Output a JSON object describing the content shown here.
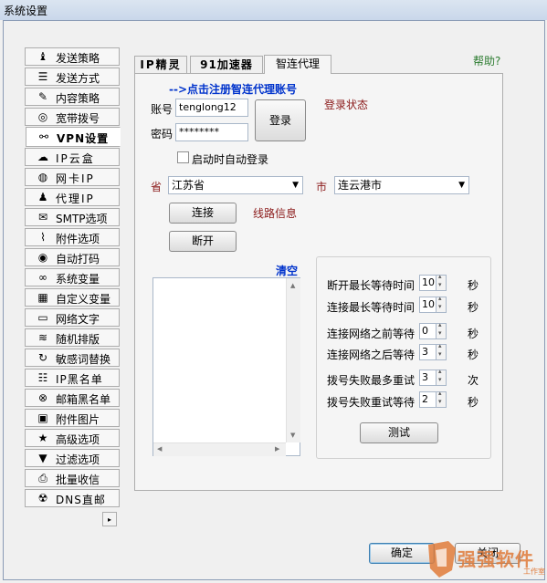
{
  "window": {
    "title": "系统设置"
  },
  "sidebar": {
    "items": [
      {
        "label": "发送策略",
        "icon": "chess-piece-icon",
        "glyph": "♝",
        "active": false
      },
      {
        "label": "发送方式",
        "icon": "list-icon",
        "glyph": "☰",
        "active": false
      },
      {
        "label": "内容策略",
        "icon": "pencil-icon",
        "glyph": "✎",
        "active": false
      },
      {
        "label": "宽带拨号",
        "icon": "globe-icon",
        "glyph": "◎",
        "active": false
      },
      {
        "label": "VPN设置",
        "icon": "link-icon",
        "glyph": "⚯",
        "active": true
      },
      {
        "label": "IP云盒",
        "icon": "cloud-icon",
        "glyph": "☁",
        "active": false
      },
      {
        "label": "网卡IP",
        "icon": "globe-icon",
        "glyph": "◍",
        "active": false
      },
      {
        "label": "代理IP",
        "icon": "user-tree-icon",
        "glyph": "♟",
        "active": false
      },
      {
        "label": "SMTP选项",
        "icon": "envelope-icon",
        "glyph": "✉",
        "active": false
      },
      {
        "label": "附件选项",
        "icon": "paperclip-icon",
        "glyph": "⌇",
        "active": false
      },
      {
        "label": "自动打码",
        "icon": "eye-icon",
        "glyph": "◉",
        "active": false
      },
      {
        "label": "系统变量",
        "icon": "infinity-icon",
        "glyph": "∞",
        "active": false
      },
      {
        "label": "自定义变量",
        "icon": "grid-icon",
        "glyph": "▦",
        "active": false
      },
      {
        "label": "网络文字",
        "icon": "book-icon",
        "glyph": "▭",
        "active": false
      },
      {
        "label": "随机排版",
        "icon": "stack-icon",
        "glyph": "≋",
        "active": false
      },
      {
        "label": "敏感词替换",
        "icon": "refresh-icon",
        "glyph": "↻",
        "active": false
      },
      {
        "label": "IP黑名单",
        "icon": "list-icon",
        "glyph": "☷",
        "active": false
      },
      {
        "label": "邮箱黑名单",
        "icon": "block-icon",
        "glyph": "⊗",
        "active": false
      },
      {
        "label": "附件图片",
        "icon": "image-icon",
        "glyph": "▣",
        "active": false
      },
      {
        "label": "高级选项",
        "icon": "star-icon",
        "glyph": "★",
        "active": false
      },
      {
        "label": "过滤选项",
        "icon": "filter-icon",
        "glyph": "▼",
        "active": false
      },
      {
        "label": "批量收信",
        "icon": "inbox-icon",
        "glyph": "⎙",
        "active": false
      },
      {
        "label": "DNS直邮",
        "icon": "radiation-icon",
        "glyph": "☢",
        "active": false
      }
    ],
    "scroll_glyph": "▸"
  },
  "tabs": [
    {
      "label": "IP精灵"
    },
    {
      "label": "91加速器"
    },
    {
      "label": "智连代理"
    }
  ],
  "help_label": "帮助?",
  "login": {
    "register_link": "-->点击注册智连代理账号",
    "account_label": "账号",
    "account_value": "tenglong12",
    "password_label": "密码",
    "password_value": "********",
    "login_button": "登录",
    "status_label": "登录状态",
    "autologin_label": "启动时自动登录"
  },
  "location": {
    "province_label": "省",
    "province_value": "江苏省",
    "city_label": "市",
    "city_value": "连云港市"
  },
  "connect_button": "连接",
  "line_info_label": "线路信息",
  "disconnect_button": "断开",
  "log": {
    "clear_label": "清空"
  },
  "settings": [
    {
      "label": "断开最长等待时间",
      "value": "10",
      "unit": "秒"
    },
    {
      "label": "连接最长等待时间",
      "value": "10",
      "unit": "秒"
    },
    {
      "label": "连接网络之前等待",
      "value": "0",
      "unit": "秒"
    },
    {
      "label": "连接网络之后等待",
      "value": "3",
      "unit": "秒"
    },
    {
      "label": "拨号失败最多重试",
      "value": "3",
      "unit": "次"
    },
    {
      "label": "拨号失败重试等待",
      "value": "2",
      "unit": "秒"
    }
  ],
  "test_button": "测试",
  "footer": {
    "ok_button": "确定",
    "close_button": "关闭"
  },
  "watermark": {
    "text": "强强软件",
    "sub": "工作室"
  }
}
